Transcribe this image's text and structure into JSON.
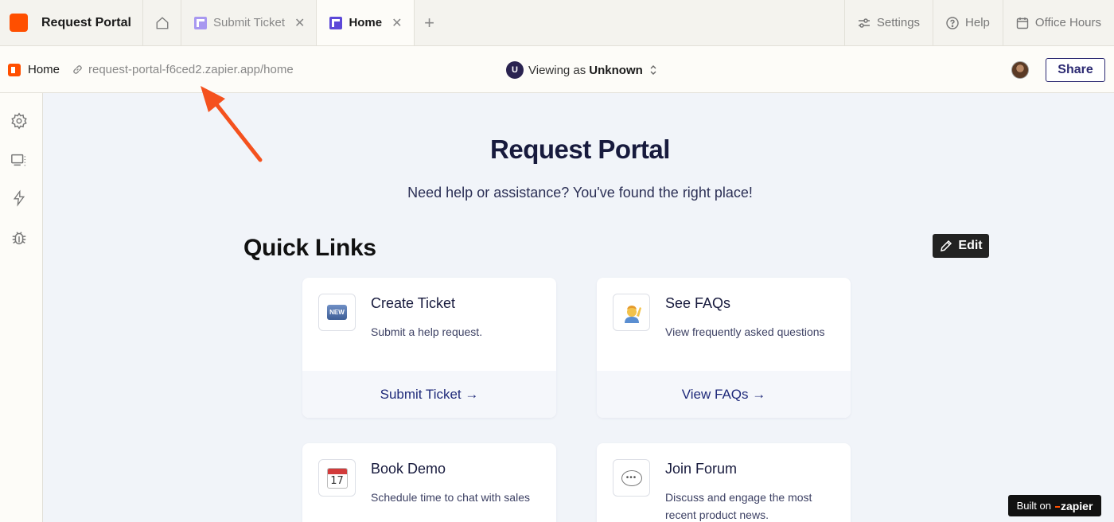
{
  "app": {
    "title": "Request Portal",
    "brand_color": "#ff4f00"
  },
  "tabs": [
    {
      "label": "Submit Ticket",
      "active": false
    },
    {
      "label": "Home",
      "active": true
    }
  ],
  "top_actions": {
    "settings": "Settings",
    "help": "Help",
    "office_hours": "Office Hours"
  },
  "urlbar": {
    "page_label": "Home",
    "url": "request-portal-f6ced2.zapier.app/home",
    "viewing_prefix": "Viewing as",
    "viewing_user": "Unknown",
    "viewing_initial": "U",
    "share_label": "Share"
  },
  "sidebar": {
    "icons": [
      "gear-icon",
      "screens-icon",
      "lightning-icon",
      "bug-icon"
    ]
  },
  "main": {
    "title": "Request Portal",
    "subtitle": "Need help or assistance? You've found the right place!",
    "quick_links_title": "Quick Links",
    "edit_label": "Edit"
  },
  "cards": [
    {
      "icon": "new-icon",
      "icon_text": "NEW",
      "title": "Create Ticket",
      "description": "Submit a help request.",
      "action": "Submit Ticket →"
    },
    {
      "icon": "person-raising-hand-icon",
      "title": "See FAQs",
      "description": "View frequently asked questions",
      "action": "View FAQs →"
    },
    {
      "icon": "calendar-icon",
      "icon_text": "17",
      "title": "Book Demo",
      "description": "Schedule time to chat with sales"
    },
    {
      "icon": "speech-bubble-icon",
      "title": "Join Forum",
      "description": "Discuss and engage the most recent product news."
    }
  ],
  "footer_badge": {
    "prefix": "Built on",
    "brand": "zapier"
  },
  "colors": {
    "accent": "#ff4f00",
    "navy": "#171a3d",
    "link": "#1f2a7a",
    "share_border": "#2c2a72"
  }
}
